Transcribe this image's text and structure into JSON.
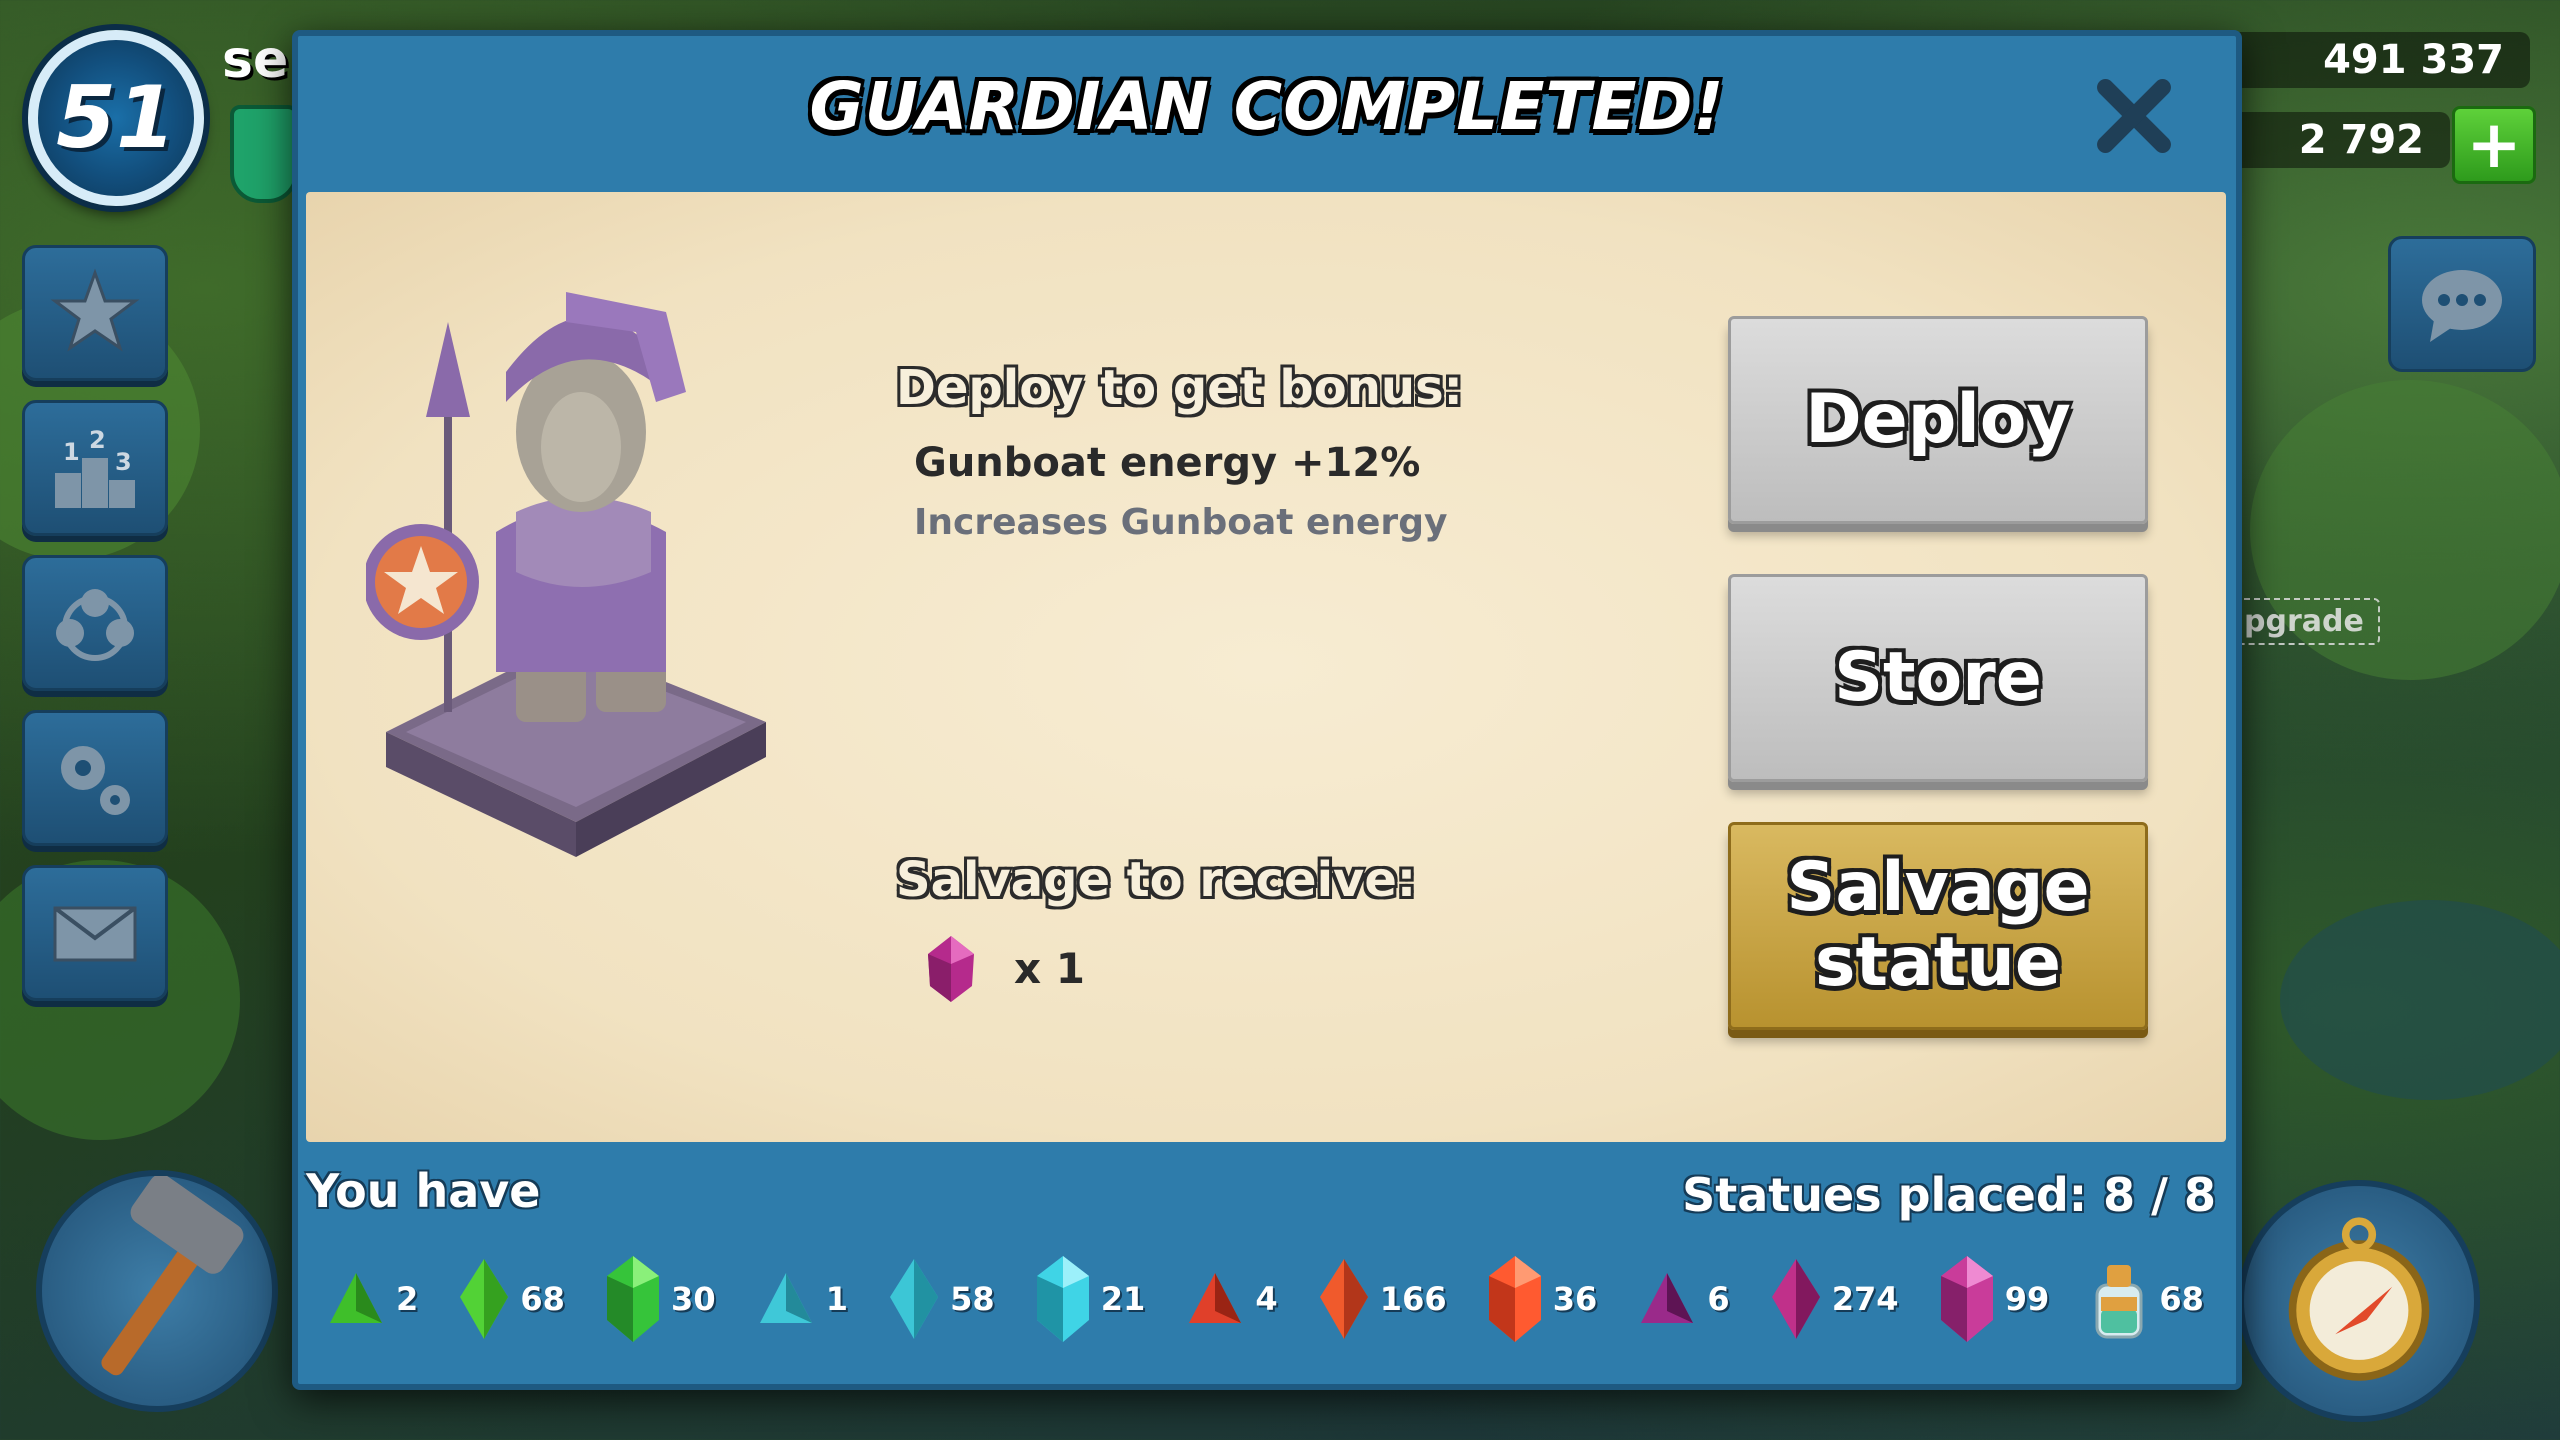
{
  "hud": {
    "level": "51",
    "player_name": "se",
    "gold": "491 337",
    "diamonds": "2 792",
    "plus_label": "+",
    "upgrade_label": "pgrade"
  },
  "modal": {
    "title": "GUARDIAN COMPLETED!",
    "close_icon": "close-icon",
    "bonus_heading": "Deploy to get bonus:",
    "bonus_title": "Gunboat energy +12%",
    "bonus_desc": "Increases Gunboat energy",
    "salvage_heading": "Salvage to receive:",
    "salvage_qty": "x 1",
    "deploy_label": "Deploy",
    "store_label": "Store",
    "salvage_label_line1": "Salvage",
    "salvage_label_line2": "statue",
    "you_have_label": "You have",
    "statues_placed": "Statues placed: 8 / 8"
  },
  "inventory": [
    {
      "icon": "green-fragment-icon",
      "count": "2",
      "color": "#3fbf2a"
    },
    {
      "icon": "green-shard-icon",
      "count": "68",
      "color": "#52d236"
    },
    {
      "icon": "green-crystal-icon",
      "count": "30",
      "color": "#36c43a"
    },
    {
      "icon": "blue-fragment-icon",
      "count": "1",
      "color": "#3fc8d8"
    },
    {
      "icon": "blue-shard-icon",
      "count": "58",
      "color": "#3cc6d6"
    },
    {
      "icon": "blue-crystal-icon",
      "count": "21",
      "color": "#3fd4e6"
    },
    {
      "icon": "red-fragment-icon",
      "count": "4",
      "color": "#e0402a"
    },
    {
      "icon": "red-shard-icon",
      "count": "166",
      "color": "#f05a2c"
    },
    {
      "icon": "red-crystal-icon",
      "count": "36",
      "color": "#ff5a30"
    },
    {
      "icon": "purple-fragment-icon",
      "count": "6",
      "color": "#9a2a8a"
    },
    {
      "icon": "purple-shard-icon",
      "count": "274",
      "color": "#c0308a"
    },
    {
      "icon": "purple-crystal-icon",
      "count": "99",
      "color": "#c93c9a"
    },
    {
      "icon": "powder-jar-icon",
      "count": "68",
      "color": "#e0a040"
    }
  ]
}
